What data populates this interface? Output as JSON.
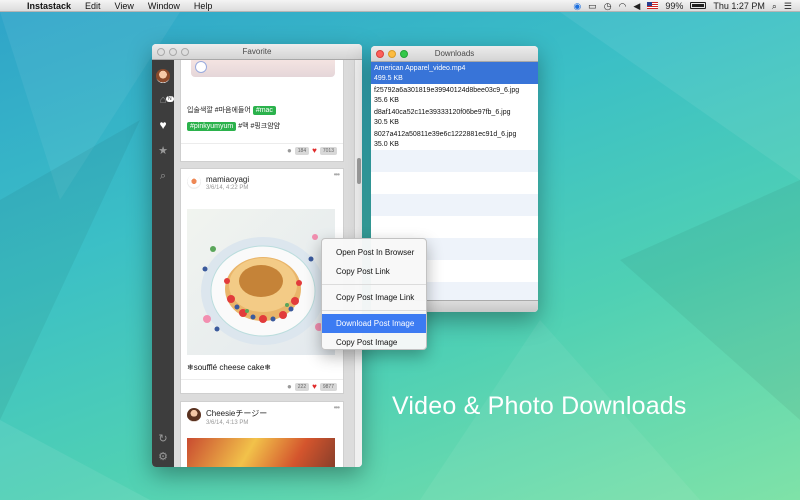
{
  "menubar": {
    "app": "Instastack",
    "menus": [
      "Edit",
      "View",
      "Window",
      "Help"
    ],
    "battery_label": "99%",
    "clock": "Thu 1:27 PM"
  },
  "favorite_window": {
    "title": "Favorite",
    "sidebar": {
      "items": [
        {
          "name": "home",
          "icon": "home-icon",
          "badge": "N"
        },
        {
          "name": "favorites",
          "icon": "heart-icon"
        },
        {
          "name": "starred",
          "icon": "star-icon"
        },
        {
          "name": "search",
          "icon": "search-icon"
        },
        {
          "name": "refresh",
          "icon": "refresh-icon"
        },
        {
          "name": "settings",
          "icon": "gear-icon"
        }
      ]
    },
    "posts": [
      {
        "korean_text": "입술색깔 #마음에들어",
        "tags": [
          "#mac",
          "#pinkyumyum"
        ],
        "trailing_text": "#맥 #핑크얌얌",
        "comments": "184",
        "likes": "7013"
      },
      {
        "username": "mamiaoyagi",
        "time": "3/6/14, 4:22 PM",
        "caption": "❄soufflé cheese cake❄",
        "comments": "222",
        "likes": "9877"
      },
      {
        "username": "Cheesieチージー",
        "time": "3/6/14, 4:13 PM"
      }
    ]
  },
  "context_menu": {
    "items": [
      "Open Post In Browser",
      "Copy Post Link",
      "Copy Post Image Link",
      "Download Post Image",
      "Copy Post Image"
    ],
    "active_index": 3
  },
  "downloads_window": {
    "title": "Downloads",
    "items": [
      {
        "name": "American Apparel_video.mp4",
        "size": "499.5 KB"
      },
      {
        "name": "f25792a6a301819e39940124d8bee03c9_6.jpg",
        "size": "35.6 KB"
      },
      {
        "name": "d8af140ca52c11e39333120f06be97fb_6.jpg",
        "size": "30.5 KB"
      },
      {
        "name": "8027a412a50811e39e6c1222881ec91d_6.jpg",
        "size": "35.0 KB"
      }
    ]
  },
  "tagline": "Video &  Photo Downloads",
  "colors": {
    "accent_green": "#2bb24c",
    "selection_blue": "#3874d8",
    "heart_red": "#e02b2b"
  }
}
